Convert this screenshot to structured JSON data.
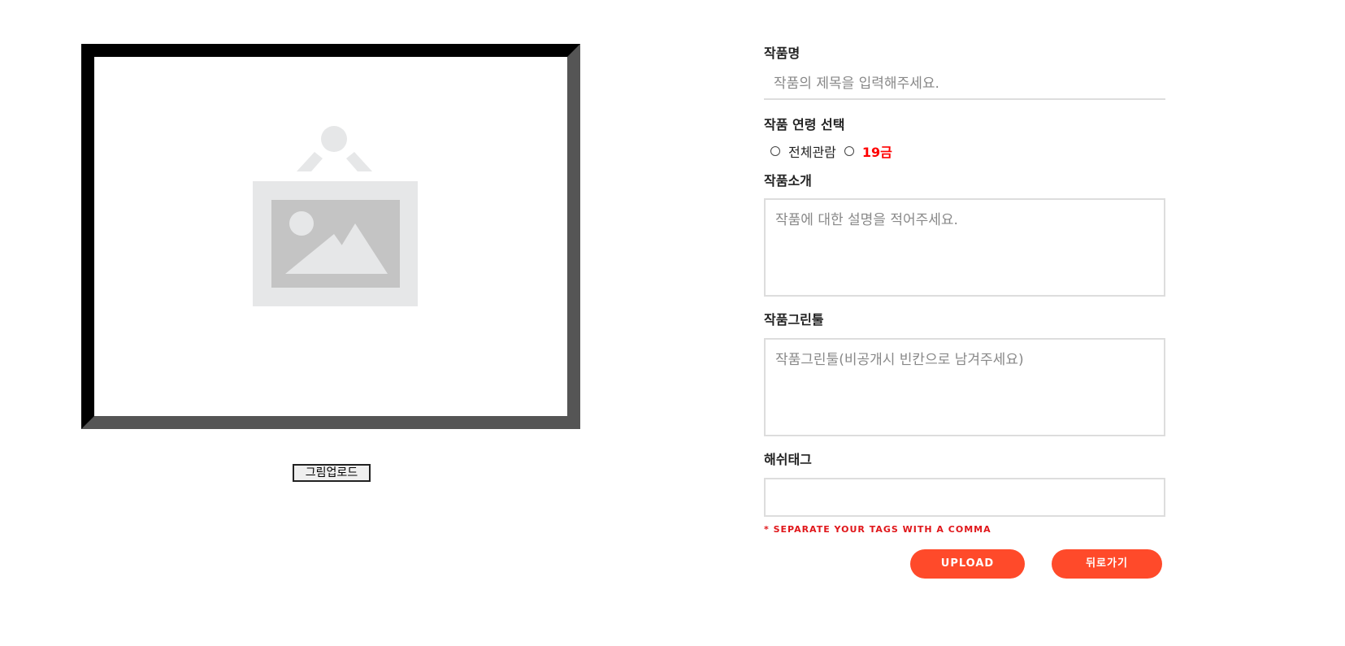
{
  "left": {
    "image_placeholder_icon": "image-placeholder-icon",
    "upload_image_button": "그림업로드"
  },
  "form": {
    "title": {
      "label": "작품명",
      "placeholder": "작품의 제목을 입력해주세요.",
      "value": ""
    },
    "age_rating": {
      "label": "작품 연령 선택",
      "options": [
        "전체관람",
        "19금"
      ],
      "selected": null
    },
    "description": {
      "label": "작품소개",
      "placeholder": "작품에 대한 설명을 적어주세요.",
      "value": ""
    },
    "tools": {
      "label": "작품그린툴",
      "placeholder": "작품그린툴(비공개시 빈칸으로 남겨주세요)",
      "value": ""
    },
    "hashtag": {
      "label": "해쉬태그",
      "value": "",
      "hint": "* SEPARATE YOUR TAGS WITH A COMMA"
    },
    "buttons": {
      "upload": "UPLOAD",
      "back": "뒤로가기"
    }
  },
  "colors": {
    "accent": "#ff4a2a",
    "adult_rating": "#ff0000",
    "hint": "#e0161a",
    "border": "#dddddd",
    "frame_dark": "#000000",
    "frame_shade": "#555555",
    "placeholder_light": "#e6e7e8",
    "placeholder_dark": "#c4c4c4"
  }
}
